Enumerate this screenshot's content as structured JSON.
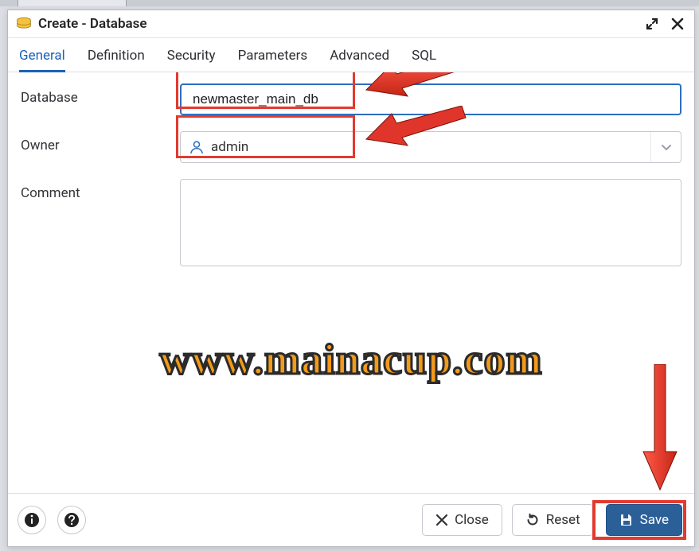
{
  "dialog": {
    "title": "Create - Database"
  },
  "tabs": {
    "general": "General",
    "definition": "Definition",
    "security": "Security",
    "parameters": "Parameters",
    "advanced": "Advanced",
    "sql": "SQL",
    "active": "general"
  },
  "form": {
    "database_label": "Database",
    "database_value": "newmaster_main_db",
    "owner_label": "Owner",
    "owner_value": "admin",
    "comment_label": "Comment",
    "comment_value": ""
  },
  "footer": {
    "close_label": "Close",
    "reset_label": "Reset",
    "save_label": "Save"
  },
  "watermark": "www.mainacup.com",
  "colors": {
    "accent": "#1b61b5",
    "save_bg": "#2b5f97",
    "annotation": "#e33a2f"
  }
}
